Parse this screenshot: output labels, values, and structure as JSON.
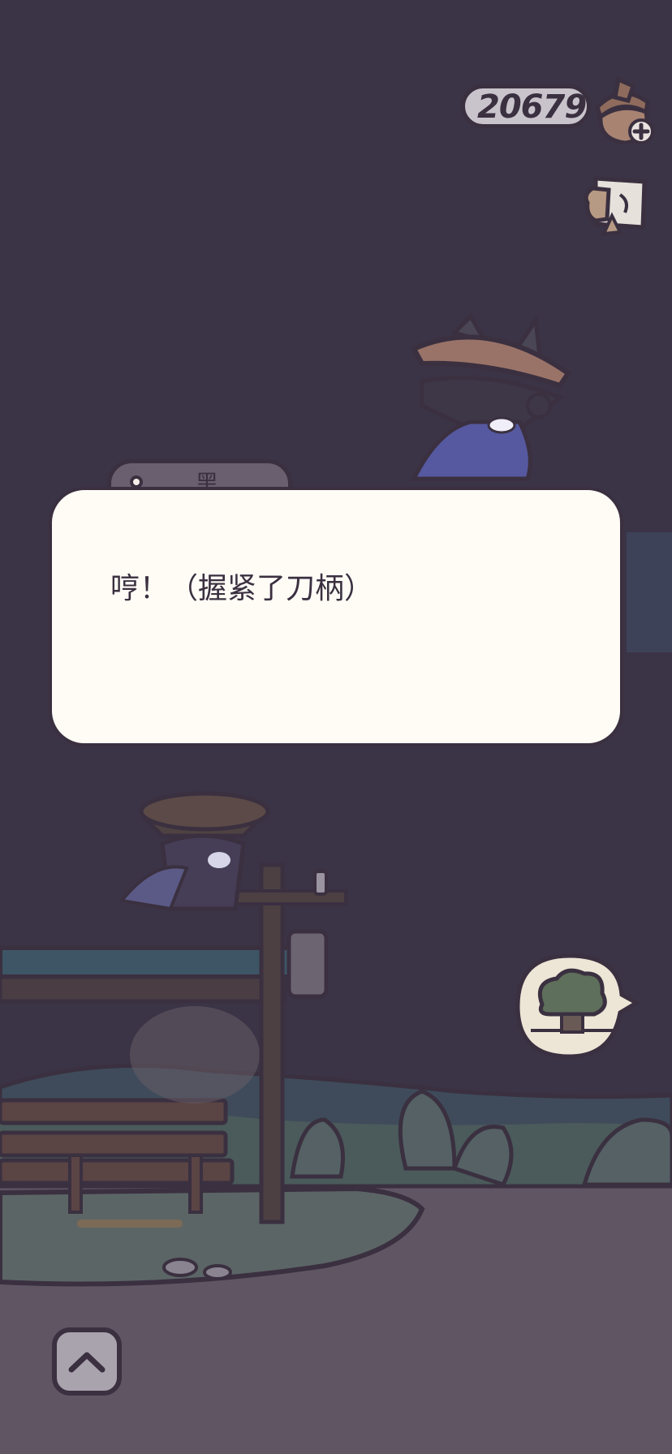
{
  "hud": {
    "currency_value": "20679",
    "currency_icon": "acorn-icon",
    "scroll_icon": "scroll-icon"
  },
  "dialog": {
    "speaker": "黑",
    "text": "哼！（握紧了刀柄）"
  },
  "controls": {
    "expand_icon": "chevron-up-icon",
    "location_icon": "tree-icon"
  },
  "colors": {
    "background": "#3b3446",
    "dialog_bg": "#fffcf6",
    "outline": "#3a3040",
    "ground": "#605663"
  }
}
